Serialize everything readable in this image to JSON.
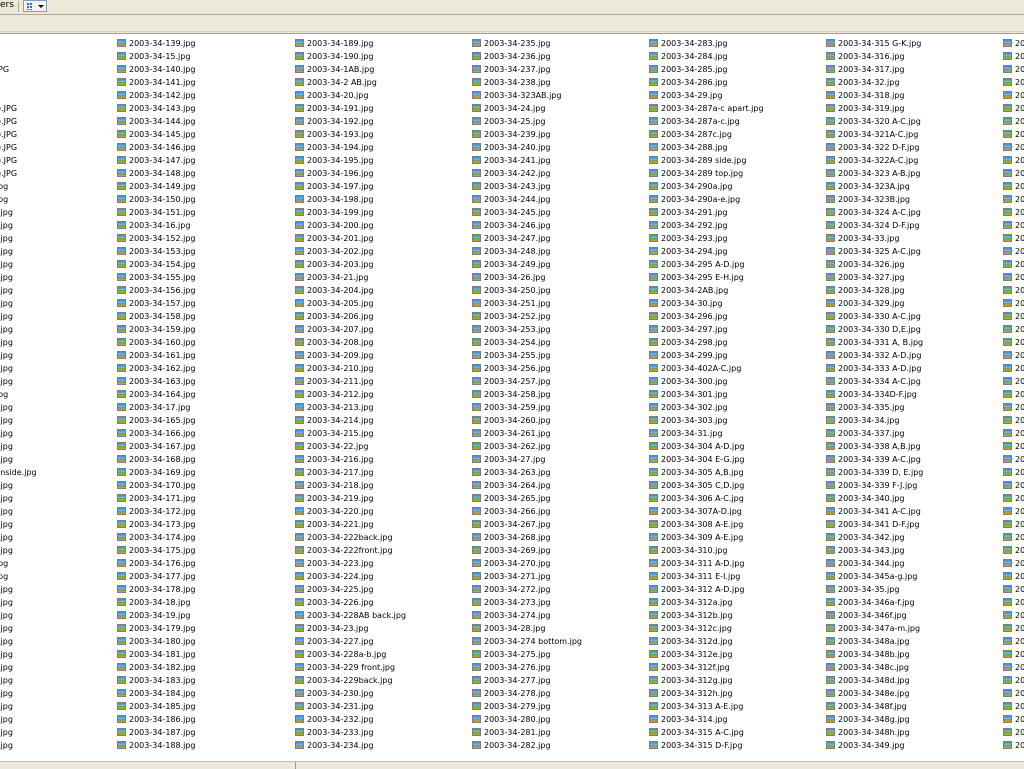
{
  "toolbar": {
    "label_partial": "ers",
    "views_icon": "views-grid-icon"
  },
  "colors": {
    "chrome": "#ece9d8",
    "file_icon": "#3d8bd0"
  },
  "columns": [
    [
      "",
      "",
      "PG",
      "",
      "",
      ").JPG",
      ").JPG",
      ").JPG",
      ").JPG",
      ").JPG",
      ").JPG",
      "pg",
      "pg",
      ".jpg",
      ".jpg",
      ".jpg",
      ".jpg",
      ".jpg",
      ".jpg",
      ".jpg",
      ".jpg",
      ".jpg",
      ".jpg",
      ".jpg",
      ".jpg",
      ".jpg",
      ".jpg",
      "pg",
      ".jpg",
      ".jpg",
      ".jpg",
      ".jpg",
      ".jpg",
      " inside.jpg",
      ".jpg",
      ".jpg",
      ".jpg",
      ".jpg",
      ".jpg",
      ".jpg",
      "pg",
      "pg",
      ".jpg",
      ".jpg",
      ".jpg",
      ".jpg",
      ".jpg",
      ".jpg",
      ".jpg",
      ".jpg",
      ".jpg",
      ".jpg",
      ".jpg",
      ".jpg",
      ".jpg"
    ],
    [
      "2003-34-139.jpg",
      "2003-34-15.jpg",
      "2003-34-140.jpg",
      "2003-34-141.jpg",
      "2003-34-142.jpg",
      "2003-34-143.jpg",
      "2003-34-144.jpg",
      "2003-34-145.jpg",
      "2003-34-146.jpg",
      "2003-34-147.jpg",
      "2003-34-148.jpg",
      "2003-34-149.jpg",
      "2003-34-150.jpg",
      "2003-34-151.jpg",
      "2003-34-16.jpg",
      "2003-34-152.jpg",
      "2003-34-153.jpg",
      "2003-34-154.jpg",
      "2003-34-155.jpg",
      "2003-34-156.jpg",
      "2003-34-157.jpg",
      "2003-34-158.jpg",
      "2003-34-159.jpg",
      "2003-34-160.jpg",
      "2003-34-161.jpg",
      "2003-34-162.jpg",
      "2003-34-163.jpg",
      "2003-34-164.jpg",
      "2003-34-17.jpg",
      "2003-34-165.jpg",
      "2003-34-166.jpg",
      "2003-34-167.jpg",
      "2003-34-168.jpg",
      "2003-34-169.jpg",
      "2003-34-170.jpg",
      "2003-34-171.jpg",
      "2003-34-172.jpg",
      "2003-34-173.jpg",
      "2003-34-174.jpg",
      "2003-34-175.jpg",
      "2003-34-176.jpg",
      "2003-34-177.jpg",
      "2003-34-178.jpg",
      "2003-34-18.jpg",
      "2003-34-19.jpg",
      "2003-34-179.jpg",
      "2003-34-180.jpg",
      "2003-34-181.jpg",
      "2003-34-182.jpg",
      "2003-34-183.jpg",
      "2003-34-184.jpg",
      "2003-34-185.jpg",
      "2003-34-186.jpg",
      "2003-34-187.jpg",
      "2003-34-188.jpg"
    ],
    [
      "2003-34-189.jpg",
      "2003-34-190.jpg",
      "2003-34-1AB.jpg",
      "2003-34-2 AB.jpg",
      "2003-34-20.jpg",
      "2003-34-191.jpg",
      "2003-34-192.jpg",
      "2003-34-193.jpg",
      "2003-34-194.jpg",
      "2003-34-195.jpg",
      "2003-34-196.jpg",
      "2003-34-197.jpg",
      "2003-34-198.jpg",
      "2003-34-199.jpg",
      "2003-34-200.jpg",
      "2003-34-201.jpg",
      "2003-34-202.jpg",
      "2003-34-203.jpg",
      "2003-34-21.jpg",
      "2003-34-204.jpg",
      "2003-34-205.jpg",
      "2003-34-206.jpg",
      "2003-34-207.jpg",
      "2003-34-208.jpg",
      "2003-34-209.jpg",
      "2003-34-210.jpg",
      "2003-34-211.jpg",
      "2003-34-212.jpg",
      "2003-34-213.jpg",
      "2003-34-214.jpg",
      "2003-34-215.jpg",
      "2003-34-22.jpg",
      "2003-34-216.jpg",
      "2003-34-217.jpg",
      "2003-34-218.jpg",
      "2003-34-219.jpg",
      "2003-34-220.jpg",
      "2003-34-221.jpg",
      "2003-34-222back.jpg",
      "2003-34-222front.jpg",
      "2003-34-223.jpg",
      "2003-34-224.jpg",
      "2003-34-225.jpg",
      "2003-34-226.jpg",
      "2003-34-228AB back.jpg",
      "2003-34-23.jpg",
      "2003-34-227.jpg",
      "2003-34-228a-b.jpg",
      "2003-34-229 front.jpg",
      "2003-34-229back.jpg",
      "2003-34-230.jpg",
      "2003-34-231.jpg",
      "2003-34-232.jpg",
      "2003-34-233.jpg",
      "2003-34-234.jpg"
    ],
    [
      "2003-34-235.jpg",
      "2003-34-236.jpg",
      "2003-34-237.jpg",
      "2003-34-238.jpg",
      "2003-34-323AB.jpg",
      "2003-34-24.jpg",
      "2003-34-25.jpg",
      "2003-34-239.jpg",
      "2003-34-240.jpg",
      "2003-34-241.jpg",
      "2003-34-242.jpg",
      "2003-34-243.jpg",
      "2003-34-244.jpg",
      "2003-34-245.jpg",
      "2003-34-246.jpg",
      "2003-34-247.jpg",
      "2003-34-248.jpg",
      "2003-34-249.jpg",
      "2003-34-26.jpg",
      "2003-34-250.jpg",
      "2003-34-251.jpg",
      "2003-34-252.jpg",
      "2003-34-253.jpg",
      "2003-34-254.jpg",
      "2003-34-255.jpg",
      "2003-34-256.jpg",
      "2003-34-257.jpg",
      "2003-34-258.jpg",
      "2003-34-259.jpg",
      "2003-34-260.jpg",
      "2003-34-261.jpg",
      "2003-34-262.jpg",
      "2003-34-27.jpg",
      "2003-34-263.jpg",
      "2003-34-264.jpg",
      "2003-34-265.jpg",
      "2003-34-266.jpg",
      "2003-34-267.jpg",
      "2003-34-268.jpg",
      "2003-34-269.jpg",
      "2003-34-270.jpg",
      "2003-34-271.jpg",
      "2003-34-272.jpg",
      "2003-34-273.jpg",
      "2003-34-274.jpg",
      "2003-34-28.jpg",
      "2003-34-274 bottom.jpg",
      "2003-34-275.jpg",
      "2003-34-276.jpg",
      "2003-34-277.jpg",
      "2003-34-278.jpg",
      "2003-34-279.jpg",
      "2003-34-280.jpg",
      "2003-34-281.jpg",
      "2003-34-282.jpg"
    ],
    [
      "2003-34-283.jpg",
      "2003-34-284.jpg",
      "2003-34-285.jpg",
      "2003-34-286.jpg",
      "2003-34-29.jpg",
      "2003-34-287a-c apart.jpg",
      "2003-34-287a-c.jpg",
      "2003-34-287c.jpg",
      "2003-34-288.jpg",
      "2003-34-289 side.jpg",
      "2003-34-289 top.jpg",
      "2003-34-290a.jpg",
      "2003-34-290a-e.jpg",
      "2003-34-291.jpg",
      "2003-34-292.jpg",
      "2003-34-293.jpg",
      "2003-34-294.jpg",
      "2003-34-295 A-D.jpg",
      "2003-34-295 E-H.jpg",
      "2003-34-2AB.jpg",
      "2003-34-30.jpg",
      "2003-34-296.jpg",
      "2003-34-297.jpg",
      "2003-34-298.jpg",
      "2003-34-299.jpg",
      "2003-34-402A-C.jpg",
      "2003-34-300.jpg",
      "2003-34-301.jpg",
      "2003-34-302.jpg",
      "2003-34-303.jpg",
      "2003-34-31.jpg",
      "2003-34-304 A-D.jpg",
      "2003-34-304 E-G.jpg",
      "2003-34-305 A,B.jpg",
      "2003-34-305 C,D.jpg",
      "2003-34-306 A-C.jpg",
      "2003-34-307A-D.jpg",
      "2003-34-308 A-E.jpg",
      "2003-34-309 A-E.jpg",
      "2003-34-310.jpg",
      "2003-34-311 A-D.jpg",
      "2003-34-311 E-I.jpg",
      "2003-34-312 A-D.jpg",
      "2003-34-312a.jpg",
      "2003-34-312b.jpg",
      "2003-34-312c.jpg",
      "2003-34-312d.jpg",
      "2003-34-312e.jpg",
      "2003-34-312f.jpg",
      "2003-34-312g.jpg",
      "2003-34-312h.jpg",
      "2003-34-313 A-E.jpg",
      "2003-34-314.jpg",
      "2003-34-315 A-C.jpg",
      "2003-34-315 D-F.jpg"
    ],
    [
      "2003-34-315 G-K.jpg",
      "2003-34-316.jpg",
      "2003-34-317.jpg",
      "2003-34-32.jpg",
      "2003-34-318.jpg",
      "2003-34-319.jpg",
      "2003-34-320 A-C.jpg",
      "2003-34-321A-C.jpg",
      "2003-34-322 D-F.jpg",
      "2003-34-322A-C.jpg",
      "2003-34-323 A-B.jpg",
      "2003-34-323A.jpg",
      "2003-34-323B.jpg",
      "2003-34-324 A-C.jpg",
      "2003-34-324 D-F.jpg",
      "2003-34-33.jpg",
      "2003-34-325 A-C.jpg",
      "2003-34-326.jpg",
      "2003-34-327.jpg",
      "2003-34-328.jpg",
      "2003-34-329.jpg",
      "2003-34-330 A-C.jpg",
      "2003-34-330 D,E.jpg",
      "2003-34-331 A, B.jpg",
      "2003-34-332 A-D.jpg",
      "2003-34-333 A-D.jpg",
      "2003-34-334 A-C.jpg",
      "2003-34-334D-F.jpg",
      "2003-34-335.jpg",
      "2003-34-34.jpg",
      "2003-34-337.jpg",
      "2003-34-338 A,B.jpg",
      "2003-34-339 A-C.jpg",
      "2003-34-339 D, E.jpg",
      "2003-34-339 F-J.jpg",
      "2003-34-340.jpg",
      "2003-34-341 A-C.jpg",
      "2003-34-341 D-F.jpg",
      "2003-34-342.jpg",
      "2003-34-343.jpg",
      "2003-34-344.jpg",
      "2003-34-345a-g.jpg",
      "2003-34-35.jpg",
      "2003-34-346a-f.jpg",
      "2003-34-346f.jpg",
      "2003-34-347a-m.jpg",
      "2003-34-348a.jpg",
      "2003-34-348b.jpg",
      "2003-34-348c.jpg",
      "2003-34-348d.jpg",
      "2003-34-348e.jpg",
      "2003-34-348f.jpg",
      "2003-34-348g.jpg",
      "2003-34-348h.jpg",
      "2003-34-349.jpg"
    ],
    [
      "20",
      "20",
      "20",
      "20",
      "20",
      "20",
      "20",
      "20",
      "20",
      "20",
      "20",
      "20",
      "20",
      "20",
      "20",
      "20",
      "20",
      "20",
      "20",
      "20",
      "20",
      "20",
      "20",
      "20",
      "20",
      "20",
      "20",
      "20",
      "20",
      "20",
      "20",
      "20",
      "20",
      "20",
      "20",
      "20",
      "20",
      "20",
      "20",
      "20",
      "20",
      "20",
      "20",
      "20",
      "20",
      "20",
      "20",
      "20",
      "20",
      "20",
      "20",
      "20",
      "20",
      "20",
      "20"
    ]
  ]
}
